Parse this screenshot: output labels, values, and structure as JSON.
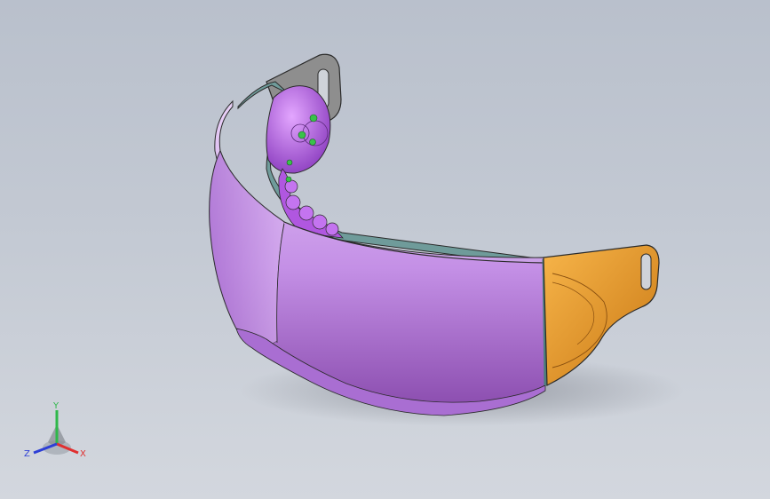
{
  "viewport": {
    "background_top": "#b9c0cc",
    "background_bottom": "#d3d7de"
  },
  "model": {
    "parts": [
      {
        "name": "visor-shell",
        "color": "#c08ae0"
      },
      {
        "name": "inner-frame",
        "color": "#6f9b9a"
      },
      {
        "name": "left-strap-tab",
        "color": "#8c8c8c"
      },
      {
        "name": "right-strap-tab",
        "color": "#e69a2e"
      },
      {
        "name": "massage-pad-cluster",
        "color": "#b45ee0"
      },
      {
        "name": "pad-nodes",
        "color": "#39c24a"
      }
    ]
  },
  "triad": {
    "x_label": "X",
    "y_label": "Y",
    "z_label": "Z",
    "x_color": "#e03030",
    "y_color": "#2fb84a",
    "z_color": "#2d3fd6"
  }
}
